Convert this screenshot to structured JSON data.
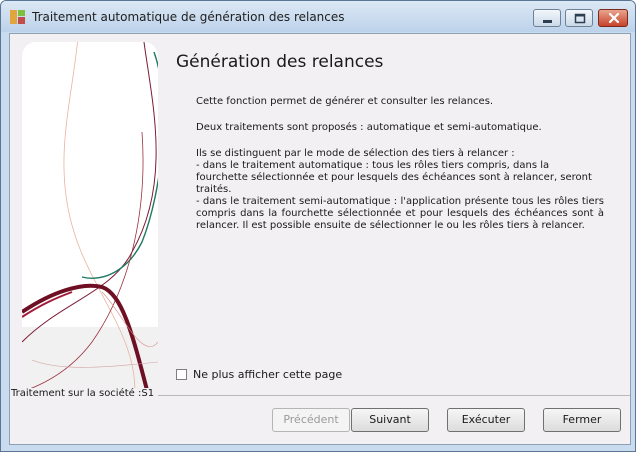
{
  "window": {
    "title": "Traitement automatique de génération des relances"
  },
  "page": {
    "heading": "Génération des relances",
    "intro": "Cette fonction permet de générer et consulter les relances.",
    "modes": "Deux traitements sont proposés : automatique et semi-automatique.",
    "distinction_lines": [
      "Ils se distinguent par le mode de sélection des tiers à relancer :",
      "- dans le traitement automatique : tous les rôles tiers compris, dans la fourchette sélectionnée et pour lesquels des échéances sont à relancer, seront traités.",
      "- dans le traitement semi-automatique : l'application présente tous les rôles tiers compris dans la fourchette sélectionnée et pour lesquels des échéances sont à relancer. Il est possible ensuite de sélectionner le ou les rôles tiers à relancer."
    ],
    "checkbox_label": "Ne plus afficher cette page",
    "checkbox_checked": false,
    "company_label": "Traitement sur la société :S1"
  },
  "buttons": {
    "previous": "Précédent",
    "previous_enabled": false,
    "next": "Suivant",
    "execute": "Exécuter",
    "close": "Fermer"
  },
  "colors": {
    "accent_teal": "#1e7a62",
    "accent_wine": "#6e0f24"
  }
}
